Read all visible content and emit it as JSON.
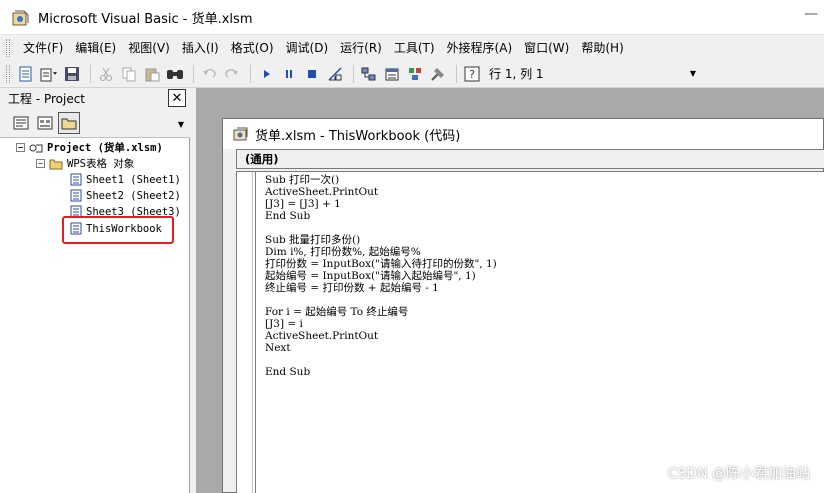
{
  "window": {
    "title": "Microsoft Visual Basic - 货单.xlsm",
    "app_icon": "vba-icon"
  },
  "menu": [
    "文件(F)",
    "编辑(E)",
    "视图(V)",
    "插入(I)",
    "格式(O)",
    "调试(D)",
    "运行(R)",
    "工具(T)",
    "外接程序(A)",
    "窗口(W)",
    "帮助(H)"
  ],
  "toolbar": {
    "icons": [
      "view-excel-icon",
      "insert-module-icon",
      "save-icon",
      "cut-icon",
      "copy-icon",
      "paste-icon",
      "find-icon",
      "undo-icon",
      "redo-icon",
      "run-icon",
      "pause-icon",
      "reset-icon",
      "design-mode-icon",
      "project-explorer-icon",
      "properties-icon",
      "object-browser-icon",
      "toolbox-icon",
      "help-icon"
    ],
    "position": "行 1, 列 1"
  },
  "project": {
    "title": "工程 - Project",
    "close_label": "✕",
    "tree": {
      "root": "Project (货单.xlsm)",
      "folder": "WPS表格 对象",
      "items": [
        "Sheet1 (Sheet1)",
        "Sheet2 (Sheet2)",
        "Sheet3 (Sheet3)",
        "ThisWorkbook"
      ]
    }
  },
  "code_window": {
    "title": "货单.xlsm - ThisWorkbook (代码)",
    "object_combo": "(通用)",
    "lines": [
      "Sub 打印一次()",
      "ActiveSheet.PrintOut",
      "[J3] = [J3] + 1",
      "End Sub",
      "",
      "Sub 批量打印多份()",
      "Dim i%, 打印份数%, 起始编号%",
      "打印份数 = InputBox(\"请输入待打印的份数\", 1)",
      "起始编号 = InputBox(\"请输入起始编号\", 1)",
      "终止编号 = 打印份数 + 起始编号 - 1",
      "",
      "For i = 起始编号 To 终止编号",
      "[J3] = i",
      "ActiveSheet.PrintOut",
      "Next",
      "",
      "End Sub"
    ]
  },
  "watermark": "CSDN @陈小君加油站",
  "colors": {
    "highlight": "#e02020",
    "mdi_background": "#a9a9a9",
    "chrome": "#f0f0f0"
  }
}
